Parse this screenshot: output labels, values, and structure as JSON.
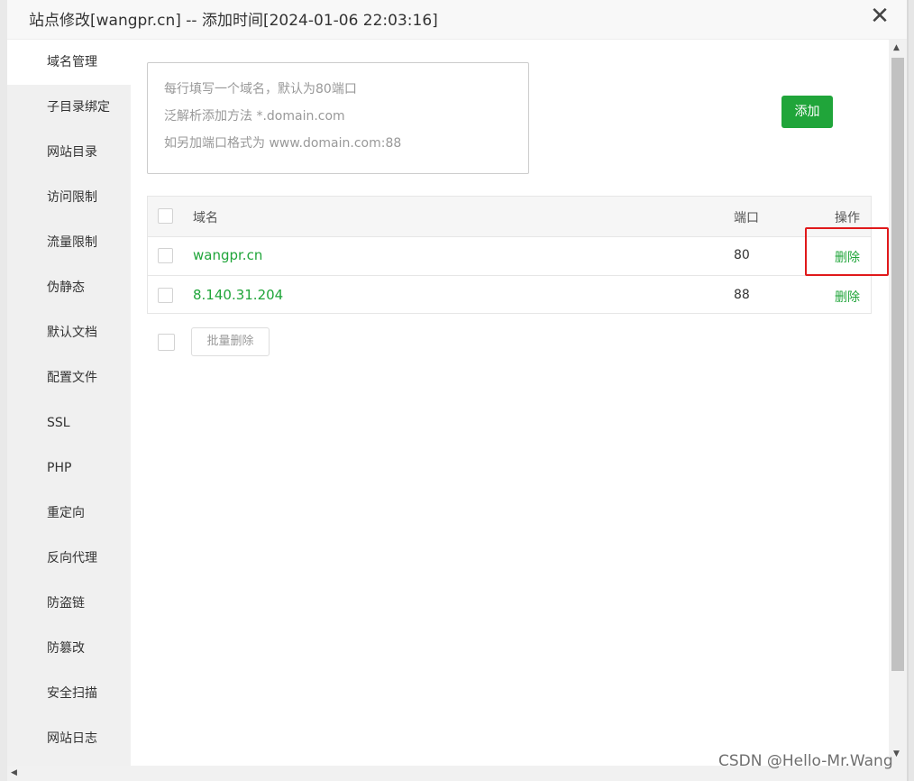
{
  "dialog": {
    "title": "站点修改[wangpr.cn] -- 添加时间[2024-01-06 22:03:16]",
    "close_icon": "close-icon",
    "close_glyph": "✕"
  },
  "sidebar": {
    "items": [
      {
        "label": "域名管理",
        "active": true
      },
      {
        "label": "子目录绑定"
      },
      {
        "label": "网站目录"
      },
      {
        "label": "访问限制"
      },
      {
        "label": "流量限制"
      },
      {
        "label": "伪静态"
      },
      {
        "label": "默认文档"
      },
      {
        "label": "配置文件"
      },
      {
        "label": "SSL"
      },
      {
        "label": "PHP"
      },
      {
        "label": "重定向"
      },
      {
        "label": "反向代理"
      },
      {
        "label": "防盗链"
      },
      {
        "label": "防篡改"
      },
      {
        "label": "安全扫描"
      },
      {
        "label": "网站日志"
      }
    ]
  },
  "domain_input": {
    "placeholder_lines": [
      "每行填写一个域名，默认为80端口",
      "泛解析添加方法 *.domain.com",
      "如另加端口格式为 www.domain.com:88"
    ],
    "value": ""
  },
  "add_button": {
    "label": "添加",
    "color": "#20a53a"
  },
  "table": {
    "headers": {
      "domain": "域名",
      "port": "端口",
      "action": "操作"
    },
    "rows": [
      {
        "domain": "wangpr.cn",
        "port": "80",
        "action": "删除",
        "highlighted": true
      },
      {
        "domain": "8.140.31.204",
        "port": "88",
        "action": "删除"
      }
    ]
  },
  "bulk_delete": {
    "label": "批量删除"
  },
  "watermark": "CSDN @Hello-Mr.Wang",
  "colors": {
    "accent": "#20a53a",
    "highlight": "#e0191b"
  }
}
